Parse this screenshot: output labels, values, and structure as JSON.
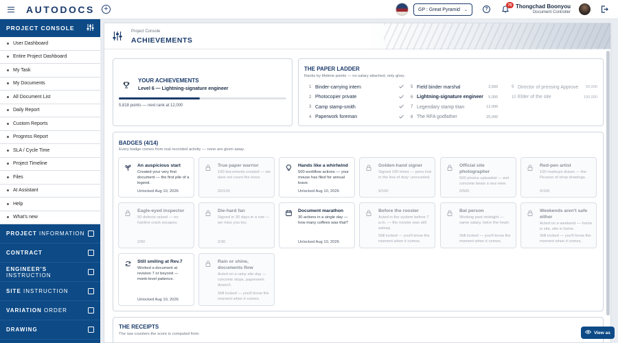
{
  "header": {
    "logo": "AUTODOCS",
    "project_select": "GP : Great Pyramid",
    "notification_count": "75",
    "user_name": "Thongchad Boonyou",
    "user_role": "Document Controller"
  },
  "sidebar": {
    "console_title": "PROJECT",
    "console_title_thin": "CONSOLE",
    "items": [
      {
        "label": "User Dashboard"
      },
      {
        "label": "Entire Project Dashboard"
      },
      {
        "label": "My Task"
      },
      {
        "label": "My Documents"
      },
      {
        "label": "All Document List"
      },
      {
        "label": "Daily Report"
      },
      {
        "label": "Custom Reports"
      },
      {
        "label": "Progress Report"
      },
      {
        "label": "SLA / Cycle Time"
      },
      {
        "label": "Project Timeline"
      },
      {
        "label": "Files"
      },
      {
        "label": "AI Assistant"
      },
      {
        "label": "Help"
      },
      {
        "label": "What's new"
      }
    ],
    "sections": [
      {
        "bold": "PROJECT",
        "thin": "INFORMATION"
      },
      {
        "bold": "CONTRACT",
        "thin": ""
      },
      {
        "bold": "ENGINEER'S",
        "thin": "INSTRUCTION"
      },
      {
        "bold": "SITE",
        "thin": "INSTRUCTION"
      },
      {
        "bold": "VARIATION",
        "thin": "ORDER"
      },
      {
        "bold": "DRAWING",
        "thin": ""
      }
    ]
  },
  "page": {
    "crumb": "Project Console",
    "title": "ACHIEVEMENTS"
  },
  "your_achievements": {
    "title": "YOUR ACHIEVEMENTS",
    "level": "Level 6 — Lightning-signature engineer",
    "points_text": "5,818 points — next rank at 12,000",
    "progress": 0.485
  },
  "ladder": {
    "title": "THE PAPER LADDER",
    "subtitle": "Ranks by lifetime points — no salary attached, only glory.",
    "rungs": [
      {
        "num": "1",
        "name": "Binder-carrying intern",
        "status": "done"
      },
      {
        "num": "2",
        "name": "Photocopier private",
        "status": "done"
      },
      {
        "num": "3",
        "name": "Camp stamp-smith",
        "status": "done"
      },
      {
        "num": "4",
        "name": "Paperwork foreman",
        "status": "done"
      },
      {
        "num": "5",
        "name": "Field binder marshal",
        "points": "2,500",
        "status": "done"
      },
      {
        "num": "6",
        "name": "Lightning-signature engineer",
        "points": "5,000",
        "status": "current"
      },
      {
        "num": "7",
        "name": "Legendary stamp titan",
        "points": "12,000",
        "status": "next"
      },
      {
        "num": "8",
        "name": "The RFA godfather",
        "points": "25,000",
        "status": "next"
      },
      {
        "num": "9",
        "name": "Director of pressing Approve",
        "points": "50,000",
        "status": "locked"
      },
      {
        "num": "10",
        "name": "Elder of the site",
        "points": "100,000",
        "status": "locked"
      }
    ]
  },
  "badges": {
    "title": "BADGES (4/14)",
    "subtitle": "Every badge comes from real recorded activity — none are given away.",
    "items": [
      {
        "title": "An auspicious start",
        "desc": "Created your very first document — the first pile of a legend.",
        "meta": "Unlocked Aug 10, 2026",
        "unlocked": true,
        "icon": "sprout-icon"
      },
      {
        "title": "True paper warrior",
        "desc": "100 documents created — we dare not count the trees.",
        "meta": "20/100",
        "unlocked": false
      },
      {
        "title": "Hands like a whirlwind",
        "desc": "500 workflow actions — your mouse has filed for annual leave.",
        "meta": "Unlocked Aug 10, 2026",
        "unlocked": true,
        "icon": "lightbulb-icon"
      },
      {
        "title": "Golden-hand signer",
        "desc": "Signed 100 times — pens lost in the line of duty: uncounted.",
        "meta": "9/100",
        "unlocked": false
      },
      {
        "title": "Official site photographer",
        "desc": "500 photos uploaded — wet concrete beats a sea view.",
        "meta": "0/500",
        "unlocked": false
      },
      {
        "title": "Red-pen artist",
        "desc": "100 markups drawn — the Picasso of shop drawings.",
        "meta": "0/100",
        "unlocked": false
      },
      {
        "title": "Eagle-eyed inspector",
        "desc": "50 defects raised — no hairline crack escapes.",
        "meta": "2/50",
        "unlocked": false
      },
      {
        "title": "Die-hard fan",
        "desc": "Signed in 30 days in a row — we miss you too.",
        "meta": "2/30",
        "unlocked": false
      },
      {
        "title": "Document marathon",
        "desc": "30 actions in a single day — how many coffees was that?",
        "meta": "Unlocked Aug 10, 2026",
        "unlocked": true,
        "icon": "calendar-icon"
      },
      {
        "title": "Before the rooster",
        "desc": "Acted in the system before 7 a.m. — the rooster was still asleep.",
        "meta": "Still locked — you'll know the moment when it comes.",
        "unlocked": false
      },
      {
        "title": "Bat person",
        "desc": "Working past midnight — same salary, twice the heart.",
        "meta": "Still locked — you'll know the moment when it comes.",
        "unlocked": false
      },
      {
        "title": "Weekends aren't safe either",
        "desc": "Acted on a weekend — home is site, site is home.",
        "meta": "Still locked — you'll know the moment when it comes.",
        "unlocked": false
      },
      {
        "title": "Still smiling at Rev.7",
        "desc": "Worked a document at revision 7 or beyond — monk-level patience.",
        "meta": "Unlocked Aug 10, 2026",
        "unlocked": true,
        "icon": "refresh-icon"
      },
      {
        "title": "Rain or shine, documents flow",
        "desc": "Acted on a rainy site day — concrete stops, paperwork doesn't.",
        "meta": "Still locked — you'll know the moment when it comes.",
        "unlocked": false
      }
    ]
  },
  "receipts": {
    "title": "THE RECEIPTS",
    "subtitle": "The raw counters the score is computed from."
  },
  "view_as": "View as"
}
